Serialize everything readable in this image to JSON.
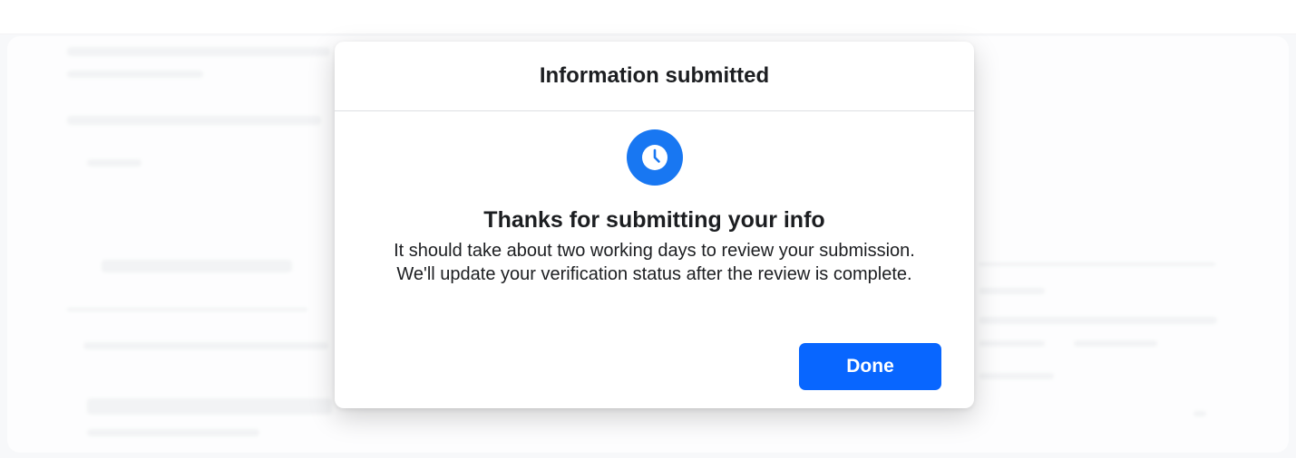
{
  "dialog": {
    "title": "Information submitted",
    "icon": "clock-icon",
    "heading": "Thanks for submitting your info",
    "message_line1": "It should take about two working days to review your submission.",
    "message_line2": "We'll update your verification status after the review is complete.",
    "done_label": "Done"
  },
  "colors": {
    "accent": "#1877f2",
    "button": "#0866ff",
    "text": "#1c1e21"
  }
}
